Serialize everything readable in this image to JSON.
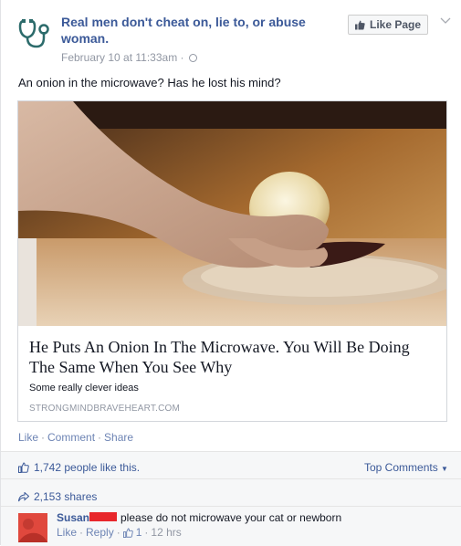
{
  "post": {
    "page_name": "Real men don't cheat on, lie to, or abuse woman.",
    "timestamp": "February 10 at 11:33am",
    "like_page_label": "Like Page",
    "text": "An onion in the microwave? Has he lost his mind?"
  },
  "link_card": {
    "title": "He Puts An Onion In The Microwave. You Will Be Doing The Same When You See Why",
    "description": "Some really clever ideas",
    "domain": "STRONGMINDBRAVEHEART.COM"
  },
  "actions": {
    "like": "Like",
    "comment": "Comment",
    "share": "Share"
  },
  "ufi": {
    "likes_text": "1,742 people like this.",
    "top_comments": "Top Comments",
    "shares_text": "2,153 shares"
  },
  "comment": {
    "author": "Susan",
    "text": "please do not microwave your cat or newborn",
    "like": "Like",
    "reply": "Reply",
    "like_count": "1",
    "time": "12 hrs"
  },
  "colors": {
    "link_blue": "#3b5998",
    "muted": "#9197a3",
    "redaction": "#e8272b"
  }
}
